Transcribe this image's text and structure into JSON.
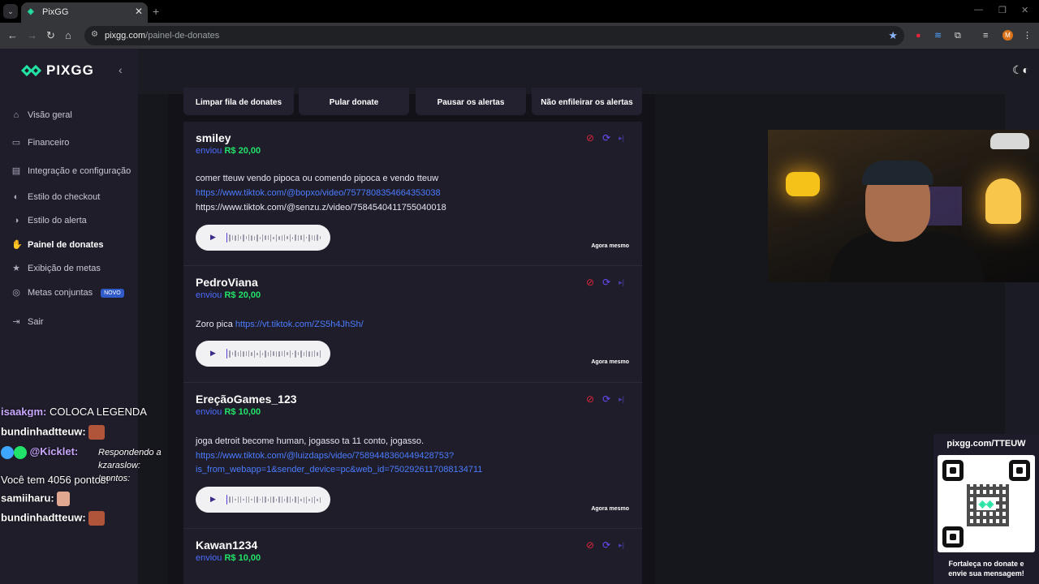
{
  "browser": {
    "tab_title": "PixGG",
    "url_domain": "pixgg.com",
    "url_path": "/painel-de-donates",
    "profile_initial": "M"
  },
  "sidebar": {
    "brand": "PIXGG",
    "items": [
      {
        "label": "Visão geral",
        "icon": "home-icon"
      },
      {
        "label": "Financeiro",
        "icon": "wallet-icon"
      },
      {
        "label": "Integração e configuração",
        "icon": "settings-icon"
      },
      {
        "label": "Estilo do checkout",
        "icon": "palette-icon"
      },
      {
        "label": "Estilo do alerta",
        "icon": "palette-icon"
      },
      {
        "label": "Painel de donates",
        "icon": "hand-coin-icon"
      },
      {
        "label": "Exibição de metas",
        "icon": "star-icon"
      },
      {
        "label": "Metas conjuntas",
        "icon": "target-icon",
        "badge": "NOVO"
      },
      {
        "label": "Sair",
        "icon": "logout-icon"
      }
    ]
  },
  "actions": {
    "clear_queue": "Limpar fila de donates",
    "skip": "Pular donate",
    "pause": "Pausar os alertas",
    "no_queue": "Não enfileirar os alertas"
  },
  "donates": [
    {
      "name": "smiley",
      "sent": "enviou",
      "amount": "R$ 20,00",
      "message": "comer tteuw vendo pipoca ou comendo pipoca e vendo tteuw",
      "link1": "https://www.tiktok.com/@bopxo/video/7577808354664353038",
      "plain": "https://www.tiktok.com/@senzu.z/video/7584540411755040018",
      "time": "Agora mesmo"
    },
    {
      "name": "PedroViana",
      "sent": "enviou",
      "amount": "R$ 20,00",
      "message": "Zoro pica",
      "link1": "https://vt.tiktok.com/ZS5h4JhSh/",
      "time": "Agora mesmo"
    },
    {
      "name": "EreçãoGames_123",
      "sent": "enviou",
      "amount": "R$ 10,00",
      "message": "joga detroit become human, jogasso ta 11 conto, jogasso.",
      "link1": "https://www.tiktok.com/@luizdaps/video/7589448360449428753?",
      "link2": "is_from_webapp=1&sender_device=pc&web_id=7502926117088134711",
      "time": "Agora mesmo"
    },
    {
      "name": "Kawan1234",
      "sent": "enviou",
      "amount": "R$ 10,00"
    }
  ],
  "chat": {
    "line0": "COLOCA LEGENDA",
    "line0_user": "isaakgm:",
    "line1_user": "bundinhadtteuw:",
    "line2_user": "@Kicklet:",
    "line2_reply": "Respondendo a kzaraslow: !pontos:",
    "line2_text": "Você tem 4056 pontos!",
    "line3_user": "samiiharu:",
    "line4_user": "bundinhadtteuw:"
  },
  "qr": {
    "url": "pixgg.com/TTEUW",
    "caption_line1": "Fortaleça no donate e",
    "caption_line2": "envie sua mensagem!"
  }
}
